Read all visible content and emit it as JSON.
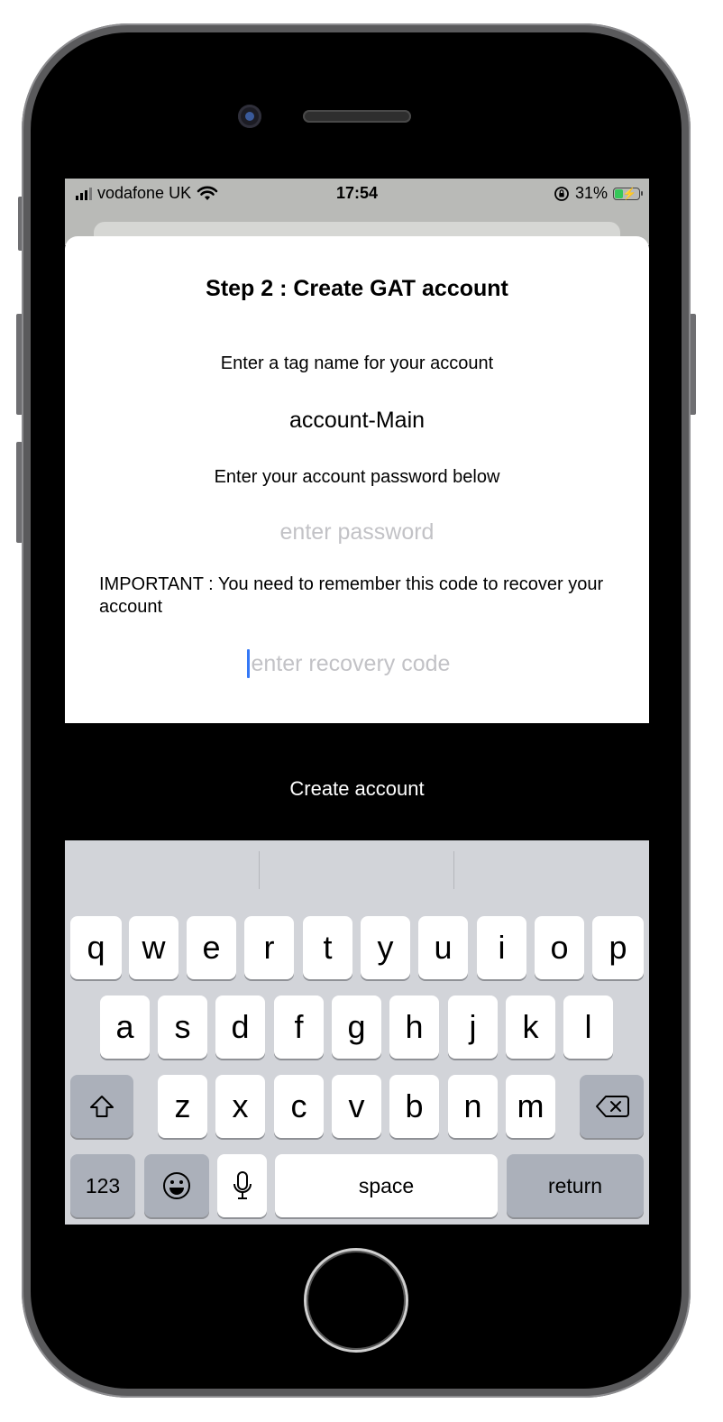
{
  "status_bar": {
    "carrier": "vodafone UK",
    "time": "17:54",
    "battery_percent": "31%"
  },
  "modal": {
    "title": "Step 2 : Create GAT account",
    "tag_label": "Enter a tag name for your account",
    "tag_value": "account-Main",
    "password_label": "Enter your account password below",
    "password_placeholder": "enter password",
    "important_note": "IMPORTANT : You need to remember this code to recover your account",
    "recovery_placeholder": "enter recovery code"
  },
  "create_button": "Create account",
  "keyboard": {
    "row1": [
      "q",
      "w",
      "e",
      "r",
      "t",
      "y",
      "u",
      "i",
      "o",
      "p"
    ],
    "row2": [
      "a",
      "s",
      "d",
      "f",
      "g",
      "h",
      "j",
      "k",
      "l"
    ],
    "row3": [
      "z",
      "x",
      "c",
      "v",
      "b",
      "n",
      "m"
    ],
    "numbers_key": "123",
    "space_key": "space",
    "return_key": "return"
  },
  "icons": {
    "wifi": "wifi-icon",
    "orientation_lock": "orientation-lock-icon",
    "battery": "battery-charging-icon",
    "shift": "shift-icon",
    "delete": "delete-icon",
    "emoji": "emoji-icon",
    "microphone": "microphone-icon"
  }
}
